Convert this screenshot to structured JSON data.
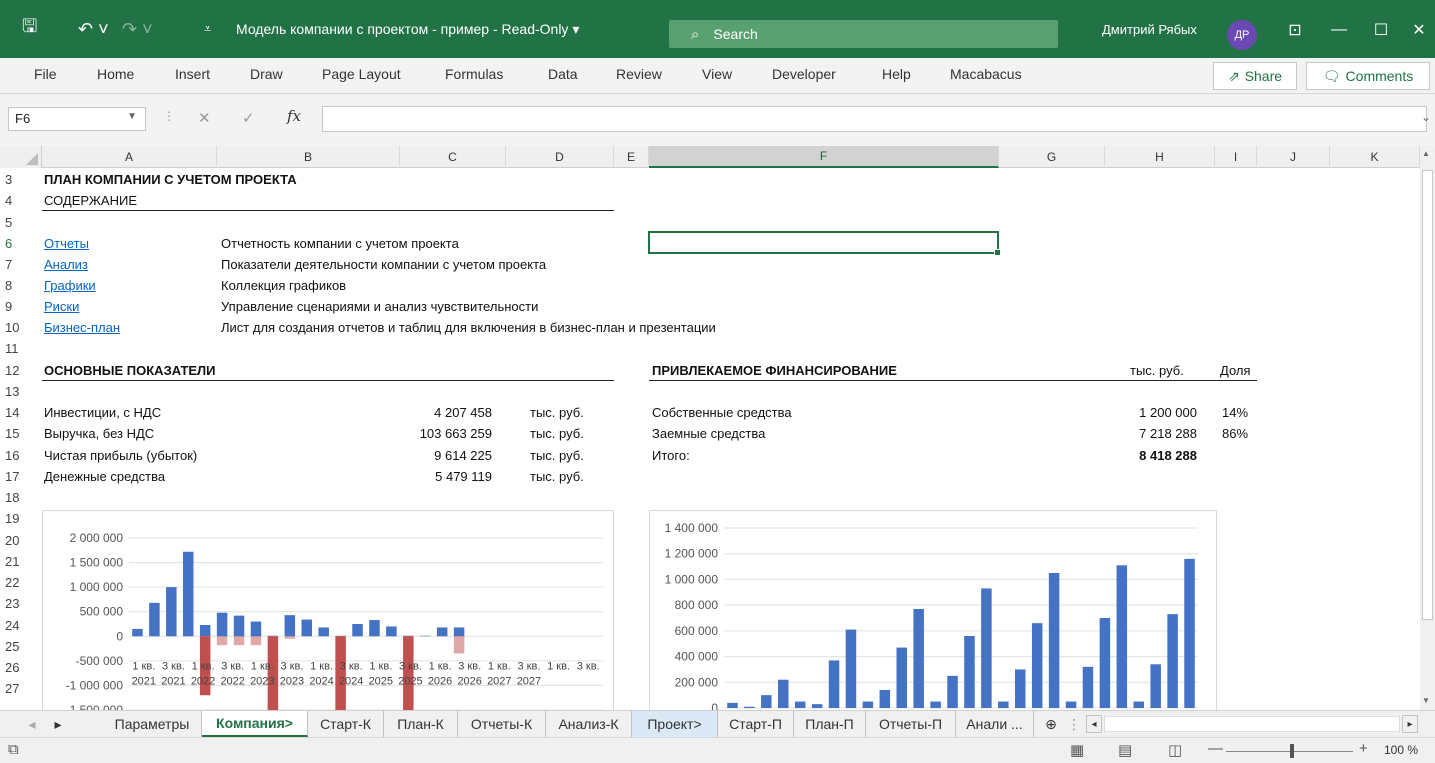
{
  "titlebar": {
    "title": "Модель компании с проектом - пример  -  Read-Only ▾",
    "search_placeholder": "Search",
    "user": "Дмитрий Рябых",
    "avatar": "ДР",
    "accent": "#217346"
  },
  "ribbon": {
    "tabs": [
      "File",
      "Home",
      "Insert",
      "Draw",
      "Page Layout",
      "Formulas",
      "Data",
      "Review",
      "View",
      "Developer",
      "Help",
      "Macabacus"
    ],
    "share": "Share",
    "comments": "Comments"
  },
  "formula_bar": {
    "name_box": "F6",
    "fx": "fx",
    "value": ""
  },
  "columns": [
    "A",
    "B",
    "C",
    "D",
    "E",
    "F",
    "G",
    "H",
    "I",
    "J",
    "K"
  ],
  "rows": [
    "3",
    "4",
    "5",
    "6",
    "7",
    "8",
    "9",
    "10",
    "11",
    "12",
    "13",
    "14",
    "15",
    "16",
    "17",
    "18",
    "19",
    "20",
    "21",
    "22",
    "23",
    "24",
    "25",
    "26",
    "27"
  ],
  "sheet": {
    "title": "ПЛАН КОМПАНИИ С  УЧЕТОМ ПРОЕКТА",
    "contents": "СОДЕРЖАНИЕ",
    "toc": [
      {
        "link": "Отчеты",
        "desc": "Отчетность компании с учетом проекта"
      },
      {
        "link": "Анализ",
        "desc": "Показатели деятельности компании с учетом проекта"
      },
      {
        "link": "Графики",
        "desc": "Коллекция графиков"
      },
      {
        "link": "Риски",
        "desc": "Управление сценариями и анализ чувствительности"
      },
      {
        "link": "Бизнес-план",
        "desc": "Лист для создания отчетов и таблиц для включения в бизнес-план и презентации"
      }
    ],
    "kpi_title": "ОСНОВНЫЕ ПОКАЗАТЕЛИ",
    "kpis": [
      {
        "label": "Инвестиции, с НДС",
        "value": "4 207 458",
        "unit": "тыс. руб."
      },
      {
        "label": "Выручка, без НДС",
        "value": "103 663 259",
        "unit": "тыс. руб."
      },
      {
        "label": "Чистая прибыль (убыток)",
        "value": "9 614 225",
        "unit": "тыс. руб."
      },
      {
        "label": "Денежные средства",
        "value": "5 479 119",
        "unit": "тыс. руб."
      }
    ],
    "fin_title": "ПРИВЛЕКАЕМОЕ ФИНАНСИРОВАНИЕ",
    "fin_unit": "тыс. руб.",
    "fin_share": "Доля",
    "financing": [
      {
        "label": "Собственные средства",
        "value": "1 200 000",
        "share": "14%"
      },
      {
        "label": "Заемные средства",
        "value": "7 218 288",
        "share": "86%"
      },
      {
        "label": "Итого:",
        "value": "8 418 288",
        "share": ""
      }
    ]
  },
  "chart_data": [
    {
      "type": "bar",
      "ylim": [
        -1500000,
        2000000
      ],
      "y_ticks": [
        "2 000 000",
        "1 500 000",
        "1 000 000",
        "500 000",
        "0",
        "-500 000",
        "-1 000 000",
        "-1 500 000"
      ],
      "x_labels_top": [
        "1 кв.",
        "3 кв.",
        "1 кв.",
        "3 кв.",
        "1 кв.",
        "3 кв.",
        "1 кв.",
        "3 кв.",
        "1 кв.",
        "3 кв.",
        "1 кв.",
        "3 кв.",
        "1 кв.",
        "3 кв.",
        "1 кв.",
        "3 кв."
      ],
      "x_labels_bottom": [
        "2021",
        "2021",
        "2022",
        "2022",
        "2023",
        "2023",
        "2024",
        "2024",
        "2025",
        "2025",
        "2026",
        "2026",
        "2027",
        "2027"
      ],
      "series": [
        {
          "color": "#4472c4",
          "values": [
            150000,
            680000,
            1000000,
            1720000,
            230000,
            480000,
            420000,
            300000,
            10000,
            430000,
            340000,
            180000,
            10000,
            250000,
            330000,
            200000,
            10000,
            10000,
            180000,
            180000,
            0,
            0,
            0,
            0,
            0,
            0,
            0,
            0
          ]
        },
        {
          "color": "#c0504d",
          "values": [
            0,
            0,
            0,
            0,
            -1200000,
            -180000,
            -180000,
            -180000,
            -1600000,
            -50000,
            0,
            0,
            -1600000,
            0,
            0,
            0,
            -1600000,
            0,
            0,
            -350000,
            0,
            0,
            0,
            0,
            0,
            0,
            0,
            0
          ]
        }
      ]
    },
    {
      "type": "bar",
      "ylim": [
        0,
        1400000
      ],
      "y_ticks": [
        "1 400 000",
        "1 200 000",
        "1 000 000",
        "800 000",
        "600 000",
        "400 000",
        "200 000",
        "0"
      ],
      "series": [
        {
          "color": "#4472c4",
          "values": [
            40000,
            10000,
            100000,
            220000,
            50000,
            30000,
            370000,
            610000,
            50000,
            140000,
            470000,
            770000,
            50000,
            250000,
            560000,
            930000,
            50000,
            300000,
            660000,
            1050000,
            50000,
            320000,
            700000,
            1110000,
            50000,
            340000,
            730000,
            1160000
          ]
        }
      ]
    }
  ],
  "sheet_tabs": [
    "Параметры",
    "Компания>",
    "Старт-К",
    "План-К",
    "Отчеты-К",
    "Анализ-К",
    "Проект>",
    "Старт-П",
    "План-П",
    "Отчеты-П",
    "Анали ..."
  ],
  "active_tab": "Компания>",
  "status": {
    "zoom": "100 %"
  }
}
